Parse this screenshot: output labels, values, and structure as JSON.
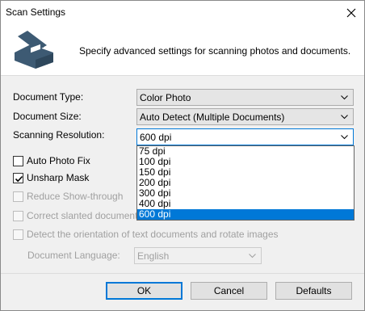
{
  "window": {
    "title": "Scan Settings"
  },
  "header": {
    "description": "Specify advanced settings for scanning photos and documents."
  },
  "fields": {
    "document_type": {
      "label": "Document Type:",
      "value": "Color Photo"
    },
    "document_size": {
      "label": "Document Size:",
      "value": "Auto Detect (Multiple Documents)"
    },
    "scanning_resolution": {
      "label": "Scanning Resolution:",
      "value": "600 dpi",
      "options": [
        "75 dpi",
        "100 dpi",
        "150 dpi",
        "200 dpi",
        "300 dpi",
        "400 dpi",
        "600 dpi"
      ]
    },
    "document_language": {
      "label": "Document Language:",
      "value": "English"
    }
  },
  "checkboxes": {
    "auto_photo_fix": {
      "label": "Auto Photo Fix",
      "checked": false,
      "enabled": true
    },
    "unsharp_mask": {
      "label": "Unsharp Mask",
      "checked": true,
      "enabled": true
    },
    "reduce_show_through": {
      "label": "Reduce Show-through",
      "checked": false,
      "enabled": false
    },
    "correct_slanted": {
      "label": "Correct slanted document",
      "checked": false,
      "enabled": false
    },
    "detect_orientation": {
      "label": "Detect the orientation of text documents and rotate images",
      "checked": false,
      "enabled": false
    }
  },
  "buttons": {
    "ok": "OK",
    "cancel": "Cancel",
    "defaults": "Defaults"
  },
  "icons": {
    "close": "close-icon",
    "scanner": "scanner-icon",
    "chevron": "chevron-down-icon",
    "check": "checkmark-icon"
  },
  "colors": {
    "accent": "#0078d7",
    "disabled_text": "#a0a0a0",
    "icon": "#3d5a73"
  }
}
